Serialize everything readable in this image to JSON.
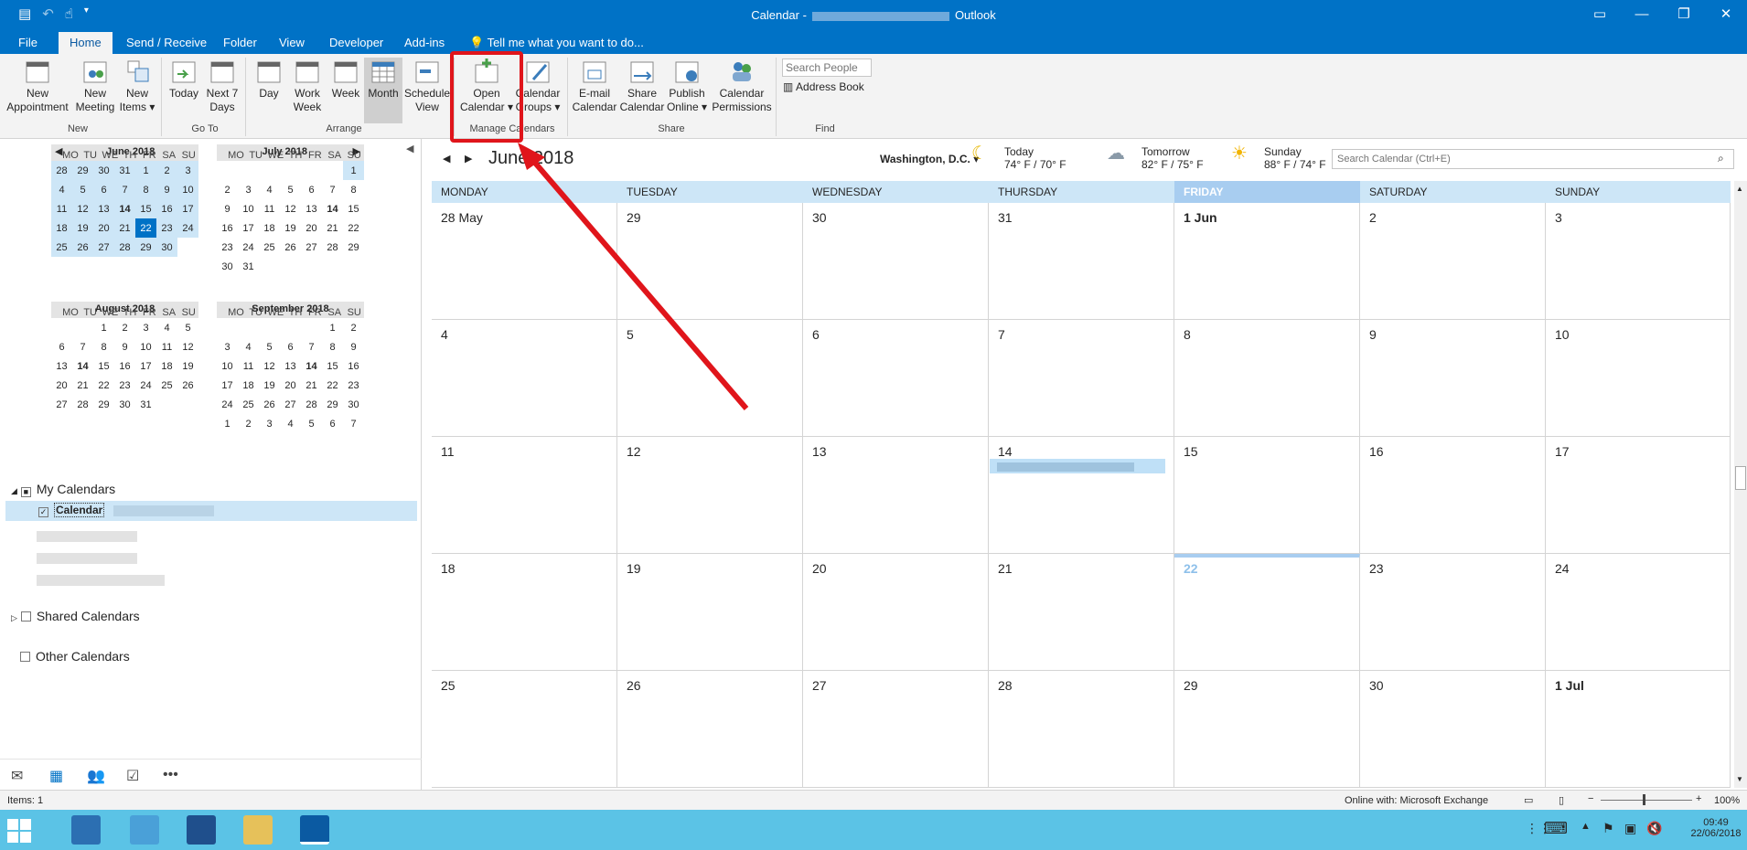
{
  "window": {
    "title_prefix": "Calendar -",
    "title_suffix": "Outlook"
  },
  "tabs": [
    "File",
    "Home",
    "Send / Receive",
    "Folder",
    "View",
    "Developer",
    "Add-ins"
  ],
  "tell_me": "Tell me what you want to do...",
  "ribbon": {
    "buttons": {
      "new_appointment": "New Appointment",
      "new_meeting": "New Meeting",
      "new_items": "New Items",
      "today": "Today",
      "next7": "Next 7 Days",
      "day": "Day",
      "work_week": "Work Week",
      "week": "Week",
      "month": "Month",
      "schedule_view": "Schedule View",
      "open_calendar": "Open Calendar",
      "calendar_groups": "Calendar Groups",
      "email_calendar": "E-mail Calendar",
      "share_calendar": "Share Calendar",
      "publish_online": "Publish Online",
      "calendar_permissions": "Calendar Permissions",
      "address_book": "Address Book"
    },
    "groups": {
      "new": "New",
      "goto": "Go To",
      "arrange": "Arrange",
      "manage": "Manage Calendars",
      "share": "Share",
      "find": "Find"
    },
    "search_people_placeholder": "Search People"
  },
  "minicals": [
    {
      "title": "June 2018"
    },
    {
      "title": "July 2018"
    },
    {
      "title": "August 2018"
    },
    {
      "title": "September 2018"
    }
  ],
  "dow_short": [
    "MO",
    "TU",
    "WE",
    "TH",
    "FR",
    "SA",
    "SU"
  ],
  "folders": {
    "my_calendars": "My Calendars",
    "calendar": "Calendar",
    "shared_calendars": "Shared Calendars",
    "other_calendars": "Other Calendars"
  },
  "calendar": {
    "month_title": "June 2018",
    "location": "Washington, D.C.",
    "weather": [
      {
        "day": "Today",
        "temp": "74° F / 70° F"
      },
      {
        "day": "Tomorrow",
        "temp": "82° F / 75° F"
      },
      {
        "day": "Sunday",
        "temp": "88° F / 74° F"
      }
    ],
    "search_placeholder": "Search Calendar (Ctrl+E)",
    "weekdays": [
      "MONDAY",
      "TUESDAY",
      "WEDNESDAY",
      "THURSDAY",
      "FRIDAY",
      "SATURDAY",
      "SUNDAY"
    ],
    "weeks": [
      [
        "28 May",
        "29",
        "30",
        "31",
        "1 Jun",
        "2",
        "3"
      ],
      [
        "4",
        "5",
        "6",
        "7",
        "8",
        "9",
        "10"
      ],
      [
        "11",
        "12",
        "13",
        "14",
        "15",
        "16",
        "17"
      ],
      [
        "18",
        "19",
        "20",
        "21",
        "22",
        "23",
        "24"
      ],
      [
        "25",
        "26",
        "27",
        "28",
        "29",
        "30",
        "1 Jul"
      ]
    ]
  },
  "status": {
    "items": "Items: 1",
    "connection": "Online with: Microsoft Exchange",
    "zoom": "100%"
  },
  "taskbar": {
    "time": "09:49",
    "date": "22/06/2018"
  },
  "colors": {
    "accent": "#0072c6",
    "highlight": "#e0151b",
    "today": "#0072c6",
    "taskbar": "#5bc3e6"
  }
}
